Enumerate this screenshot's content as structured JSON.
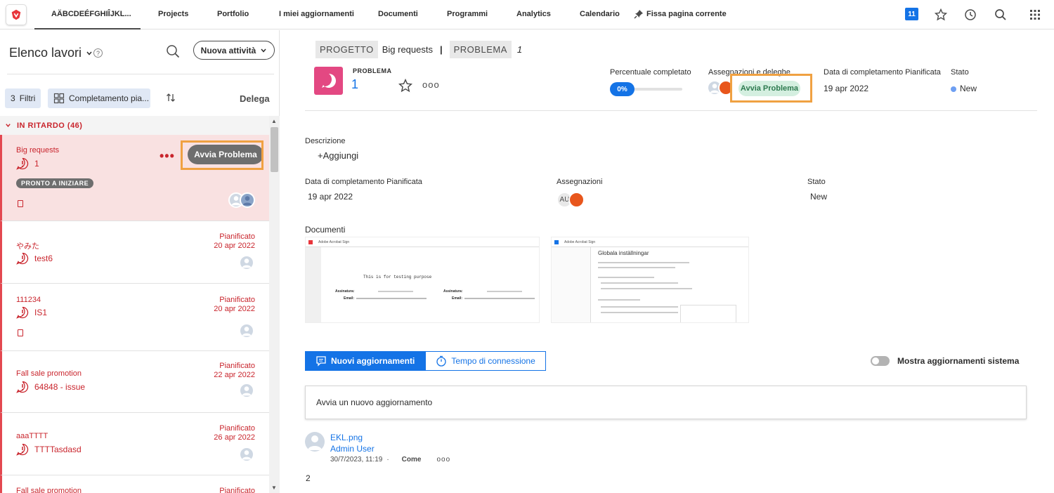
{
  "topnav": {
    "current_tab": "AÄBCDEÉFGHIÎJKL...",
    "items": [
      "Projects",
      "Portfolio",
      "I miei aggiornamenti",
      "Documenti",
      "Programmi",
      "Analytics",
      "Calendario"
    ],
    "pin_label": "Fissa pagina corrente",
    "notification_count": "11"
  },
  "left_panel": {
    "title": "Elenco lavori",
    "help": "?",
    "new_task_label": "Nuova attività",
    "filter_count": "3",
    "filter_label": "Filtri",
    "grouping_label": "Completamento pia...",
    "delegate_label": "Delega",
    "group_header": "IN RITARDO (46)",
    "selected_card": {
      "project": "Big requests",
      "name": "1",
      "badge": "PRONTO A INIZIARE",
      "action_label": "Avvia Problema"
    },
    "cards": [
      {
        "project": "やみた",
        "name": "test6",
        "status": "Pianificato",
        "date": "20 apr 2022"
      },
      {
        "project": "111234",
        "name": "IS1",
        "status": "Pianificato",
        "date": "20 apr 2022"
      },
      {
        "project": "Fall sale promotion",
        "name": "64848 - issue",
        "status": "Pianificato",
        "date": "22 apr 2022"
      },
      {
        "project": "aaaTTTT",
        "name": "TTTTasdasd",
        "status": "Pianificato",
        "date": "26 apr 2022"
      },
      {
        "project": "Fall sale promotion",
        "name": "",
        "status": "Pianificato",
        "date": ""
      }
    ]
  },
  "main": {
    "breadcrumb": {
      "project_tag": "PROGETTO",
      "project_name": "Big requests",
      "sep": "|",
      "issue_tag": "PROBLEMA",
      "issue_num": "1"
    },
    "header": {
      "type_label": "PROBLEMA",
      "number": "1",
      "percent_label": "Percentuale completato",
      "percent_value": "0%",
      "percent_fraction": 0,
      "assign_label": "Assegnazioni e deleghe",
      "action_label": "Avvia Problema",
      "planned_label": "Data di completamento Pianificata",
      "planned_value": "19 apr 2022",
      "status_label": "Stato",
      "status_value": "New"
    },
    "description_label": "Descrizione",
    "add_label": "+Aggiungi",
    "details": {
      "planned_label": "Data di completamento Pianificata",
      "planned_value": "19 apr 2022",
      "assign_label": "Assegnazioni",
      "assign_initials": "AU",
      "status_label": "Stato",
      "status_value": "New"
    },
    "documents_label": "Documenti",
    "doc1": {
      "app": "Adobe Acrobat Sign",
      "text": "This is for testing purpose",
      "signer": "Assinatura:",
      "email_label": "Email:"
    },
    "doc2": {
      "app": "Adobe Acrobat Sign",
      "heading": "Globala inställningar"
    },
    "tabs": {
      "updates": "Nuovi aggiornamenti",
      "time": "Tempo di connessione"
    },
    "toggle_label": "Mostra aggiornamenti sistema",
    "update_placeholder": "Avvia un nuovo aggiornamento",
    "update": {
      "file": "EKL.png",
      "user": "Admin User",
      "timestamp": "30/7/2023, 11:19",
      "dot": "·",
      "like": "Come",
      "body": "2"
    }
  },
  "colors": {
    "accent": "#1473e6",
    "late": "#c9252d",
    "issue": "#e34882",
    "highlight": "#f0a142"
  }
}
